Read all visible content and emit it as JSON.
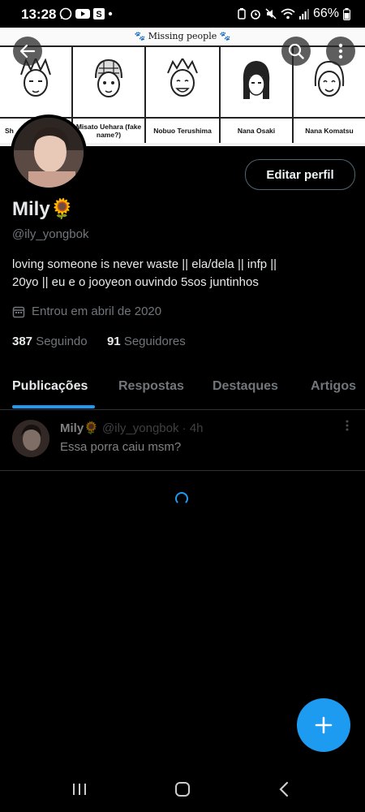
{
  "status_bar": {
    "time": "13:28",
    "battery": "66%"
  },
  "banner": {
    "header": "Missing people",
    "panels": [
      {
        "caption": "Sh"
      },
      {
        "caption": "Misato Uehara (fake name?)"
      },
      {
        "caption": "Nobuo Terushima"
      },
      {
        "caption": "Nana Osaki"
      },
      {
        "caption": "Nana Komatsu"
      }
    ]
  },
  "profile": {
    "edit_label": "Editar perfil",
    "name": "Mily🌻",
    "handle": "@ily_yongbok",
    "bio_line1": "loving someone is never waste || ela/dela || infp ||",
    "bio_line2": "20yo || eu e o jooyeon ouvindo 5sos juntinhos",
    "joined": "Entrou em abril de 2020",
    "following_count": "387",
    "following_label": "Seguindo",
    "followers_count": "91",
    "followers_label": "Seguidores"
  },
  "tabs": [
    {
      "label": "Publicações"
    },
    {
      "label": "Respostas"
    },
    {
      "label": "Destaques"
    },
    {
      "label": "Artigos"
    }
  ],
  "post": {
    "name": "Mily🌻",
    "handle": "@ily_yongbok",
    "time": "· 4h",
    "text": "Essa porra caiu msm?"
  },
  "colors": {
    "accent": "#1d9bf0",
    "background": "#000000",
    "secondary_text": "#71767b"
  }
}
